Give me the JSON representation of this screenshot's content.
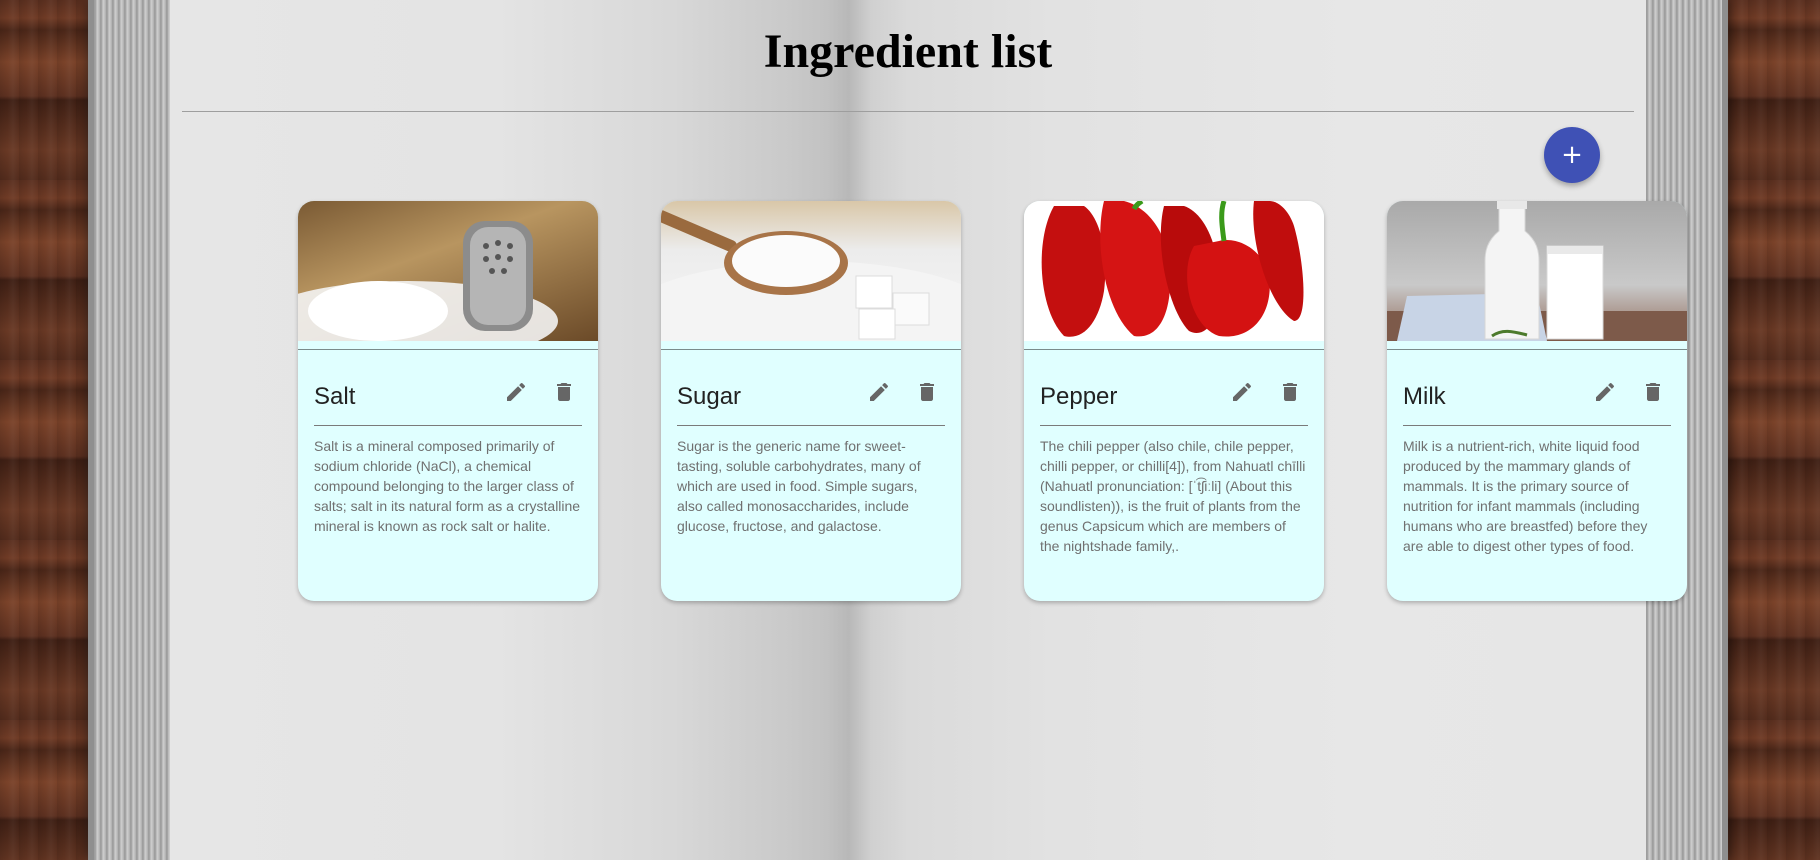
{
  "page": {
    "title": "Ingredient list"
  },
  "fab": {
    "label": "+"
  },
  "ingredients": [
    {
      "name": "Salt",
      "description": "Salt is a mineral composed primarily of sodium chloride (NaCl), a chemical compound belonging to the larger class of salts; salt in its natural form as a crystalline mineral is known as rock salt or halite."
    },
    {
      "name": "Sugar",
      "description": "Sugar is the generic name for sweet-tasting, soluble carbohydrates, many of which are used in food. Simple sugars, also called monosaccharides, include glucose, fructose, and galactose."
    },
    {
      "name": "Pepper",
      "description": "The chili pepper (also chile, chile pepper, chilli pepper, or chilli[4]), from Nahuatl chīlli (Nahuatl pronunciation: [ˈt͡ʃiːli] (About this soundlisten)), is the fruit of plants from the genus Capsicum which are members of the nightshade family,."
    },
    {
      "name": "Milk",
      "description": "Milk is a nutrient-rich, white liquid food produced by the mammary glands of mammals. It is the primary source of nutrition for infant mammals (including humans who are breastfed) before they are able to digest other types of food."
    }
  ],
  "colors": {
    "fab": "#3f51b5",
    "card_background": "#e0ffff",
    "icon": "#666666"
  },
  "icons": {
    "edit": "pencil-icon",
    "delete": "trash-icon"
  }
}
